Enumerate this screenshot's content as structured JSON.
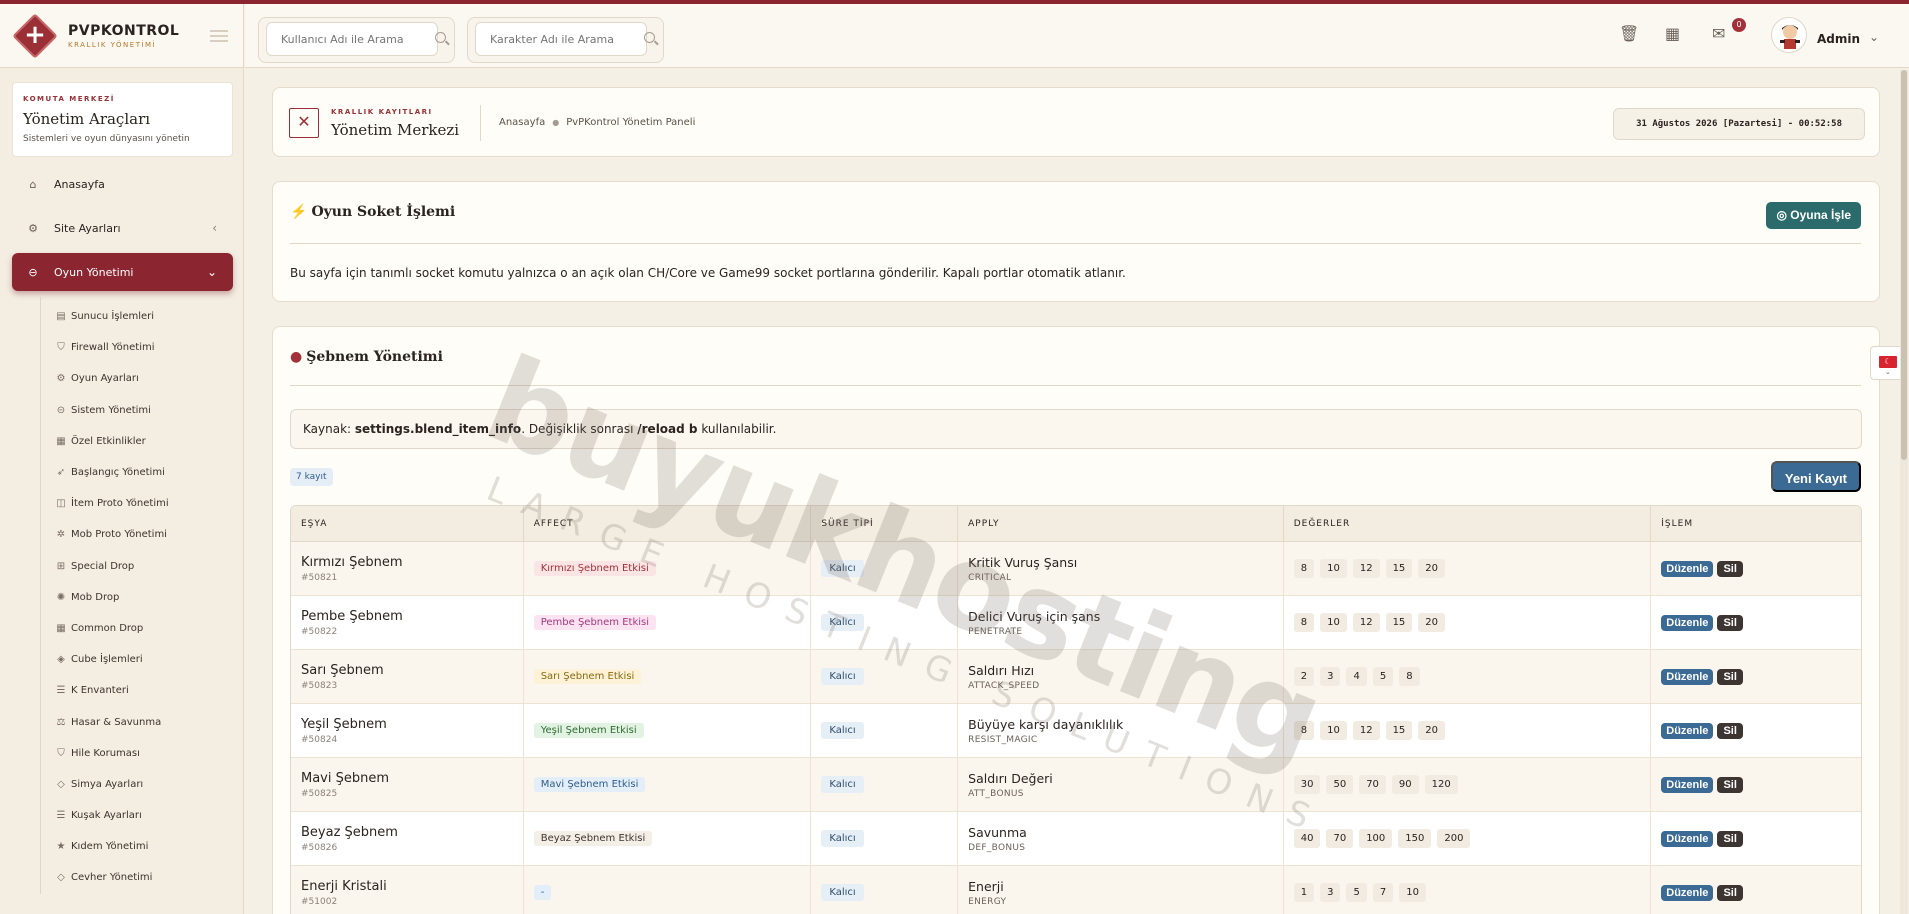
{
  "brand": {
    "title": "PVPKONTROL",
    "subtitle": "KRALLIK YÖNETİMİ"
  },
  "sidebar": {
    "card": {
      "tag": "KOMUTA MERKEZİ",
      "title": "Yönetim Araçları",
      "subtitle": "Sistemleri ve oyun dünyasını yönetin"
    },
    "items": [
      {
        "label": "Anasayfa",
        "icon": "home-icon"
      },
      {
        "label": "Site Ayarları",
        "icon": "gear-icon"
      },
      {
        "label": "Oyun Yönetimi",
        "icon": "gamepad-icon"
      }
    ],
    "sub_items": [
      {
        "label": "Sunucu İşlemleri",
        "icon": "server-icon"
      },
      {
        "label": "Firewall Yönetimi",
        "icon": "shield-icon"
      },
      {
        "label": "Oyun Ayarları",
        "icon": "gears-icon"
      },
      {
        "label": "Sistem Yönetimi",
        "icon": "toggle-icon"
      },
      {
        "label": "Özel Etkinlikler",
        "icon": "calendar-icon"
      },
      {
        "label": "Başlangıç Yönetimi",
        "icon": "rocket-icon"
      },
      {
        "label": "İtem Proto Yönetimi",
        "icon": "box-icon"
      },
      {
        "label": "Mob Proto Yönetimi",
        "icon": "paw-icon"
      },
      {
        "label": "Special Drop",
        "icon": "gift-icon"
      },
      {
        "label": "Mob Drop",
        "icon": "bug-icon"
      },
      {
        "label": "Common Drop",
        "icon": "grid-icon"
      },
      {
        "label": "Cube İşlemleri",
        "icon": "cube-icon"
      },
      {
        "label": "K Envanteri",
        "icon": "list-icon"
      },
      {
        "label": "Hasar & Savunma",
        "icon": "scale-icon"
      },
      {
        "label": "Hile Koruması",
        "icon": "shield-alt-icon"
      },
      {
        "label": "Simya Ayarları",
        "icon": "gem-icon"
      },
      {
        "label": "Kuşak Ayarları",
        "icon": "sliders-icon"
      },
      {
        "label": "Kıdem Yönetimi",
        "icon": "star-icon"
      },
      {
        "label": "Cevher Yönetimi",
        "icon": "diamond-icon"
      }
    ]
  },
  "header": {
    "search_user_placeholder": "Kullanıcı Adı ile Arama",
    "search_char_placeholder": "Karakter Adı ile Arama",
    "mail_badge": "0",
    "admin_name": "Admin"
  },
  "breadcrumb": {
    "tag": "KRALLIK KAYITLARI",
    "title": "Yönetim Merkezi",
    "home": "Anasayfa",
    "current": "PvPKontrol Yönetim Paneli",
    "datetime": "31 Ağustos 2026 [Pazartesi] - 00:52:58"
  },
  "socket": {
    "title": "Oyun Soket İşlemi",
    "button": "Oyuna İşle",
    "text": "Bu sayfa için tanımlı socket komutu yalnızca o an açık olan CH/Core ve Game99 socket portlarına gönderilir. Kapalı portlar otomatik atlanır."
  },
  "sebnem": {
    "title": "Şebnem Yönetimi",
    "info_prefix": "Kaynak: ",
    "info_source": "settings.blend_item_info",
    "info_mid": ". Değişiklik sonrası ",
    "info_cmd": "/reload b",
    "info_suffix": " kullanılabilir.",
    "count": "7 kayıt",
    "new_button": "Yeni Kayıt",
    "columns": [
      "EŞYA",
      "AFFECT",
      "SÜRE TİPİ",
      "APPLY",
      "DEĞERLER",
      "İŞLEM"
    ],
    "rows": [
      {
        "name": "Kırmızı Şebnem",
        "id": "#50821",
        "affect": "Kırmızı Şebnem Etkisi",
        "duration": "Kalıcı",
        "apply": "Kritik Vuruş Şansı",
        "apply_code": "CRITICAL",
        "values": [
          "8",
          "10",
          "12",
          "15",
          "20"
        ]
      },
      {
        "name": "Pembe Şebnem",
        "id": "#50822",
        "affect": "Pembe Şebnem Etkisi",
        "duration": "Kalıcı",
        "apply": "Delici Vuruş için şans",
        "apply_code": "PENETRATE",
        "values": [
          "8",
          "10",
          "12",
          "15",
          "20"
        ]
      },
      {
        "name": "Sarı Şebnem",
        "id": "#50823",
        "affect": "Sarı Şebnem Etkisi",
        "duration": "Kalıcı",
        "apply": "Saldırı Hızı",
        "apply_code": "ATTACK_SPEED",
        "values": [
          "2",
          "3",
          "4",
          "5",
          "8"
        ]
      },
      {
        "name": "Yeşil Şebnem",
        "id": "#50824",
        "affect": "Yeşil Şebnem Etkisi",
        "duration": "Kalıcı",
        "apply": "Büyüye karşı dayanıklılık",
        "apply_code": "RESIST_MAGIC",
        "values": [
          "8",
          "10",
          "12",
          "15",
          "20"
        ]
      },
      {
        "name": "Mavi Şebnem",
        "id": "#50825",
        "affect": "Mavi Şebnem Etkisi",
        "duration": "Kalıcı",
        "apply": "Saldırı Değeri",
        "apply_code": "ATT_BONUS",
        "values": [
          "30",
          "50",
          "70",
          "90",
          "120"
        ]
      },
      {
        "name": "Beyaz Şebnem",
        "id": "#50826",
        "affect": "Beyaz Şebnem Etkisi",
        "duration": "Kalıcı",
        "apply": "Savunma",
        "apply_code": "DEF_BONUS",
        "values": [
          "40",
          "70",
          "100",
          "150",
          "200"
        ]
      },
      {
        "name": "Enerji Kristali",
        "id": "#51002",
        "affect": "-",
        "duration": "Kalıcı",
        "apply": "Enerji",
        "apply_code": "ENERGY",
        "values": [
          "1",
          "3",
          "5",
          "7",
          "10"
        ]
      }
    ],
    "edit_label": "Düzenle",
    "delete_label": "Sil"
  },
  "watermark": {
    "brand": "buyukhosting",
    "tagline": "LARGE HOSTING SOLUTIONS"
  },
  "colors": {
    "accent": "#8b2530",
    "primary": "#3b6a94",
    "teal": "#2c6b6b",
    "dark": "#3d3532"
  }
}
